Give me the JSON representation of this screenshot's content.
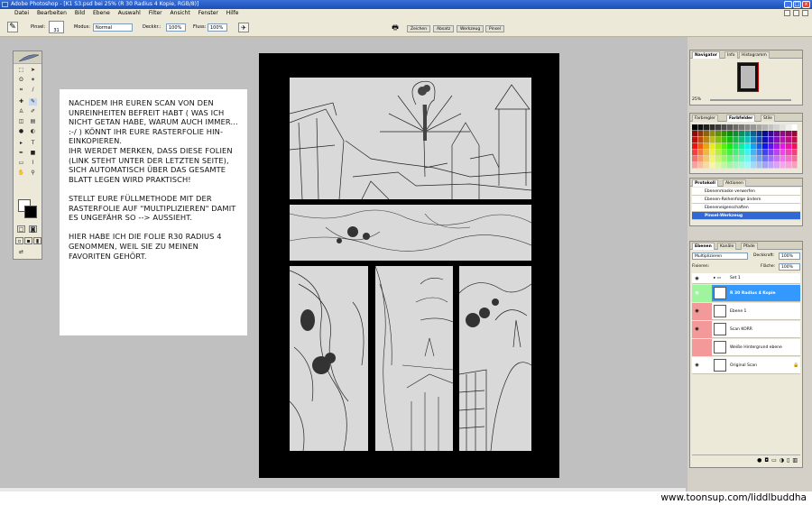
{
  "window": {
    "title": "Adobe Photoshop - [K1 S3.psd bei 25% (R 30 Radius 4 Kopie, RGB/8)]",
    "minimize": "_",
    "maximize": "□",
    "close": "x"
  },
  "menu": {
    "items": [
      "Datei",
      "Bearbeiten",
      "Bild",
      "Ebene",
      "Auswahl",
      "Filter",
      "Ansicht",
      "Fenster",
      "Hilfe"
    ]
  },
  "options": {
    "brush_label": "Pinsel:",
    "brush_size": "31",
    "mode_label": "Modus:",
    "mode_value": "Normal",
    "opacity_label": "Deckkr.:",
    "opacity_value": "100%",
    "flow_label": "Fluss:",
    "flow_value": "100%",
    "palette_tabs": [
      "Zeichen",
      "Absatz",
      "Werkzeug",
      "Pinsel"
    ]
  },
  "note": {
    "paragraphs": [
      "NACHDEM IHR EUREN SCAN VON DEN UNREINHEITEN BEFREIT HABT ( WAS ICH NICHT GETAN HABE, WARUM AUCH IMMER... :-/ ) KÖNNT IHR EURE RASTERFOLIE HIN-EINKOPIEREN.\nIHR WERDET MERKEN, DASS DIESE FOLIEN (LINK STEHT UNTER DER LETZTEN SEITE), SICH AUTOMATISCH ÜBER DAS GESAMTE BLATT LEGEN WIRD PRAKTISCH!",
      "STELLT EURE FÜLLMETHODE MIT DER RASTERFOLIE AUF \"MULTIPLIZIEREN\" DAMIT ES UNGEFÄHR SO         --> AUSSIEHT.",
      "HIER HABE ICH DIE FOLIE R30 RADIUS 4 GENOMMEN, WEIL SIE ZU MEINEN FAVORITEN GEHÖRT."
    ]
  },
  "navigator": {
    "tabs": [
      "Navigator",
      "Info",
      "Histogramm"
    ],
    "zoom": "25%"
  },
  "swatches": {
    "tabs": [
      "Farbregler",
      "Farbfelder",
      "Stile"
    ]
  },
  "history": {
    "tabs": [
      "Protokoll",
      "Aktionen"
    ],
    "items": [
      "Ebenenmaske verwerfen",
      "Ebenen-Reihenfolge ändern",
      "Ebeneneigenschaften",
      "Pinsel-Werkzeug"
    ],
    "selected_index": 3
  },
  "layers": {
    "tabs": [
      "Ebenen",
      "Kanäle",
      "Pfade"
    ],
    "blend_mode": "Multiplizieren",
    "opacity_label": "Deckkraft:",
    "opacity_value": "100%",
    "lock_label": "Fixieren:",
    "fill_label": "Fläche:",
    "fill_value": "100%",
    "items": [
      {
        "name": "Set 1",
        "type": "set"
      },
      {
        "name": "R 30 Radius 4 Kopie",
        "type": "layer",
        "selected": true
      },
      {
        "name": "Ebene 1",
        "type": "layer"
      },
      {
        "name": "Scan KORR",
        "type": "layer"
      },
      {
        "name": "Weiße Hintergrund ebene",
        "type": "layer"
      },
      {
        "name": "Original Scan",
        "type": "layer",
        "locked": true
      }
    ]
  },
  "watermark": "www.toonsup.com/liddlbuddha",
  "colors": {
    "selected_blue": "#3399ff",
    "history_selected": "#3168d5",
    "layer_pink": "#f49999",
    "layer_green": "#9ef59e",
    "workspace": "#c0c0c0"
  }
}
